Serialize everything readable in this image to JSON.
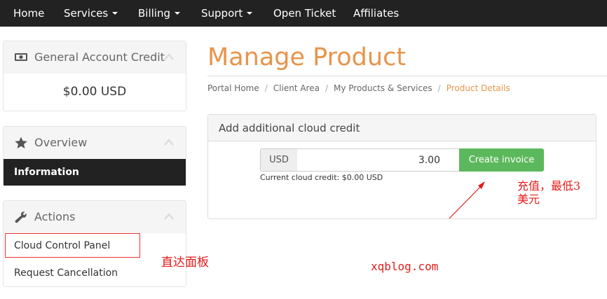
{
  "nav": {
    "home": "Home",
    "services": "Services",
    "billing": "Billing",
    "support": "Support",
    "open_ticket": "Open Ticket",
    "affiliates": "Affiliates"
  },
  "sidebar": {
    "credit": {
      "title": "General Account Credit",
      "amount": "$0.00 USD",
      "icon": "money-icon"
    },
    "overview": {
      "title": "Overview",
      "item": "Information",
      "icon": "star-icon"
    },
    "actions": {
      "title": "Actions",
      "items": [
        "Cloud Control Panel",
        "Request Cancellation"
      ],
      "icon": "wrench-icon"
    }
  },
  "main": {
    "title": "Manage Product",
    "breadcrumb": [
      "Portal Home",
      "Client Area",
      "My Products & Services",
      "Product Details"
    ],
    "card_title": "Add additional cloud credit",
    "currency": "USD",
    "amount": "3.00",
    "button": "Create invoice",
    "current_credit": "Current cloud credit: $0.00 USD"
  },
  "annotations": {
    "panel_note": "直达面板",
    "topup_note_line1": "充值，最低3",
    "topup_note_line2": "美元",
    "watermark": "xqblog.com"
  },
  "colors": {
    "nav_bg": "#222222",
    "accent": "#e8944a",
    "button": "#5cb85c",
    "annotation": "#e31b1b"
  }
}
